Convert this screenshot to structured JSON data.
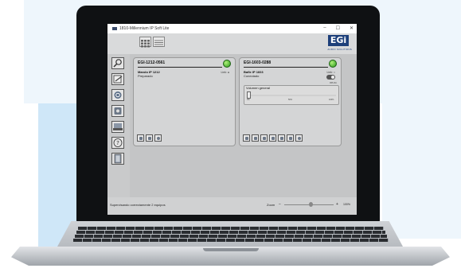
{
  "window": {
    "title": "1810-Millennium IP Soft Lite",
    "minimize": "–",
    "maximize": "☐",
    "close": "✕"
  },
  "logo": {
    "text": "EGi",
    "subtitle": "AUDIO SOLUTIONS"
  },
  "cards": [
    {
      "id": "EGI-1212-0561",
      "device_name": "Mando IP 1212",
      "status": "Preparado",
      "link_label": "Link: ●"
    },
    {
      "id": "EGI-1603-0288",
      "device_name": "Bafle IP 1603",
      "status": "Conectado",
      "link_label": "Link: ○",
      "toggle_label": "Off-On",
      "volume_label": "Volumen general",
      "volume_ticks": [
        "0%",
        "50%",
        "100%"
      ],
      "volume_value": 0
    }
  ],
  "statusbar": {
    "text": "Supervisando correctamente 2 equipos",
    "zoom_label": "Zoom",
    "zoom_minus": "−",
    "zoom_plus": "+",
    "zoom_value": "100%"
  },
  "icons": {
    "sidebar": [
      "search-icon",
      "edit-icon",
      "refresh-icon",
      "settings-icon",
      "export-icon",
      "help-icon",
      "door-icon"
    ],
    "card1_buttons": [
      "device-icon",
      "link-icon",
      "help-icon"
    ],
    "card2_buttons": [
      "device-icon",
      "link-icon",
      "eq-icon",
      "mixer-icon",
      "effects-icon",
      "config-icon",
      "help-icon"
    ]
  },
  "colors": {
    "led_green": "#2a9a1a",
    "screen_bg": "#2b3a52",
    "logo_blue": "#1d3f7a"
  }
}
